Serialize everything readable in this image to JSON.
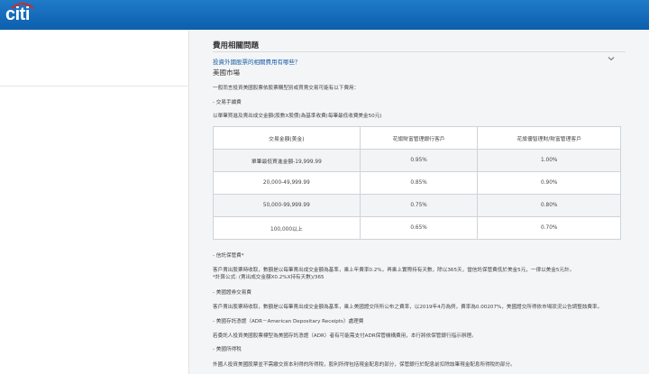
{
  "header": {
    "logo_text": "citi"
  },
  "section": {
    "title": "費用相關問題",
    "question": "投資外國股票的相關費用有哪些？",
    "market_title": "美國市場",
    "intro": "一般而言投資美國股票依股票購型別或買賣交易可能有以下費用：",
    "fee_label": "- 交易手續費",
    "fee_desc": "以單筆買進及賣出成交金額(股數X股價)為基準收費(每筆最低收費美金50元)"
  },
  "fee_table": {
    "headers": [
      "交易金額(美金)",
      "花旗財富管理銀行客戶",
      "花旗優智理財/財富管理客戶"
    ],
    "rows": [
      [
        "單筆最低買進金額-19,999.99",
        "0.95%",
        "1.00%"
      ],
      [
        "20,000-49,999.99",
        "0.85%",
        "0.90%"
      ],
      [
        "50,000-99,999.99",
        "0.75%",
        "0.80%"
      ],
      [
        "100,000以上",
        "0.65%",
        "0.70%"
      ]
    ]
  },
  "notes": {
    "custody_label": "- 信託保管費*",
    "custody_desc": "客戶賣出股票時收取，數額是以每筆賣出成交金額為基準，乘上年費率0.2%，再乘上實際持有天數，除以365天，當信託保管費低於美金5元，一律以美金5元計。",
    "custody_formula": "*計算公式: (賣出成交金額X0.2%X持有天數)/365",
    "sec_label": "- 美國證券交易費",
    "sec_desc": "客戶賣出股票時收取，數額是以每筆賣出成交金額為基準，乘上美國證交所所公布之費率，以2019年4月為例，費率為0.00207%，美國證交所得依市場狀況公告調整該費率。",
    "adr_label": "- 美國存託憑證（ADR－American Depositary Receipts）處理費",
    "adr_desc": "若委託人投資美國股票標型為美國存託憑證（ADR）者有可能需支付ADR保管機構費用，本行將依保管銀行指示辦理。",
    "tax_label": "- 美國所得稅",
    "tax_desc": "外國人投資美國股票並不需繳交資本利得的所得稅，股利所得包括現金配息的部分，保管銀行於配息前扣除該筆現金配息所得稅的部分。"
  }
}
